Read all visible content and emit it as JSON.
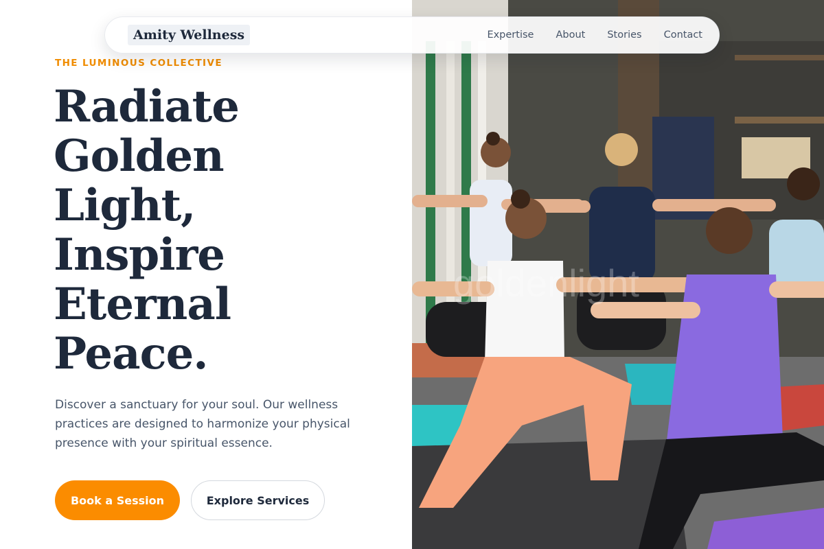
{
  "nav": {
    "brand": "Amity Wellness",
    "links": [
      "Expertise",
      "About",
      "Stories",
      "Contact"
    ]
  },
  "hero": {
    "eyebrow": "THE LUMINOUS COLLECTIVE",
    "headline_lines": [
      "Radiate",
      "Golden",
      "Light,",
      "Inspire",
      "Eternal",
      "Peace."
    ],
    "description": "Discover a sanctuary for your soul. Our wellness practices are designed to harmonize your physical presence with your spiritual essence.",
    "primary_cta": "Book a Session",
    "secondary_cta": "Explore Services",
    "image_watermark": "goldenlight"
  },
  "colors": {
    "accent": "#fb8c00",
    "eyebrow": "#f08c00",
    "heading": "#1e293b",
    "body_text": "#475569"
  }
}
